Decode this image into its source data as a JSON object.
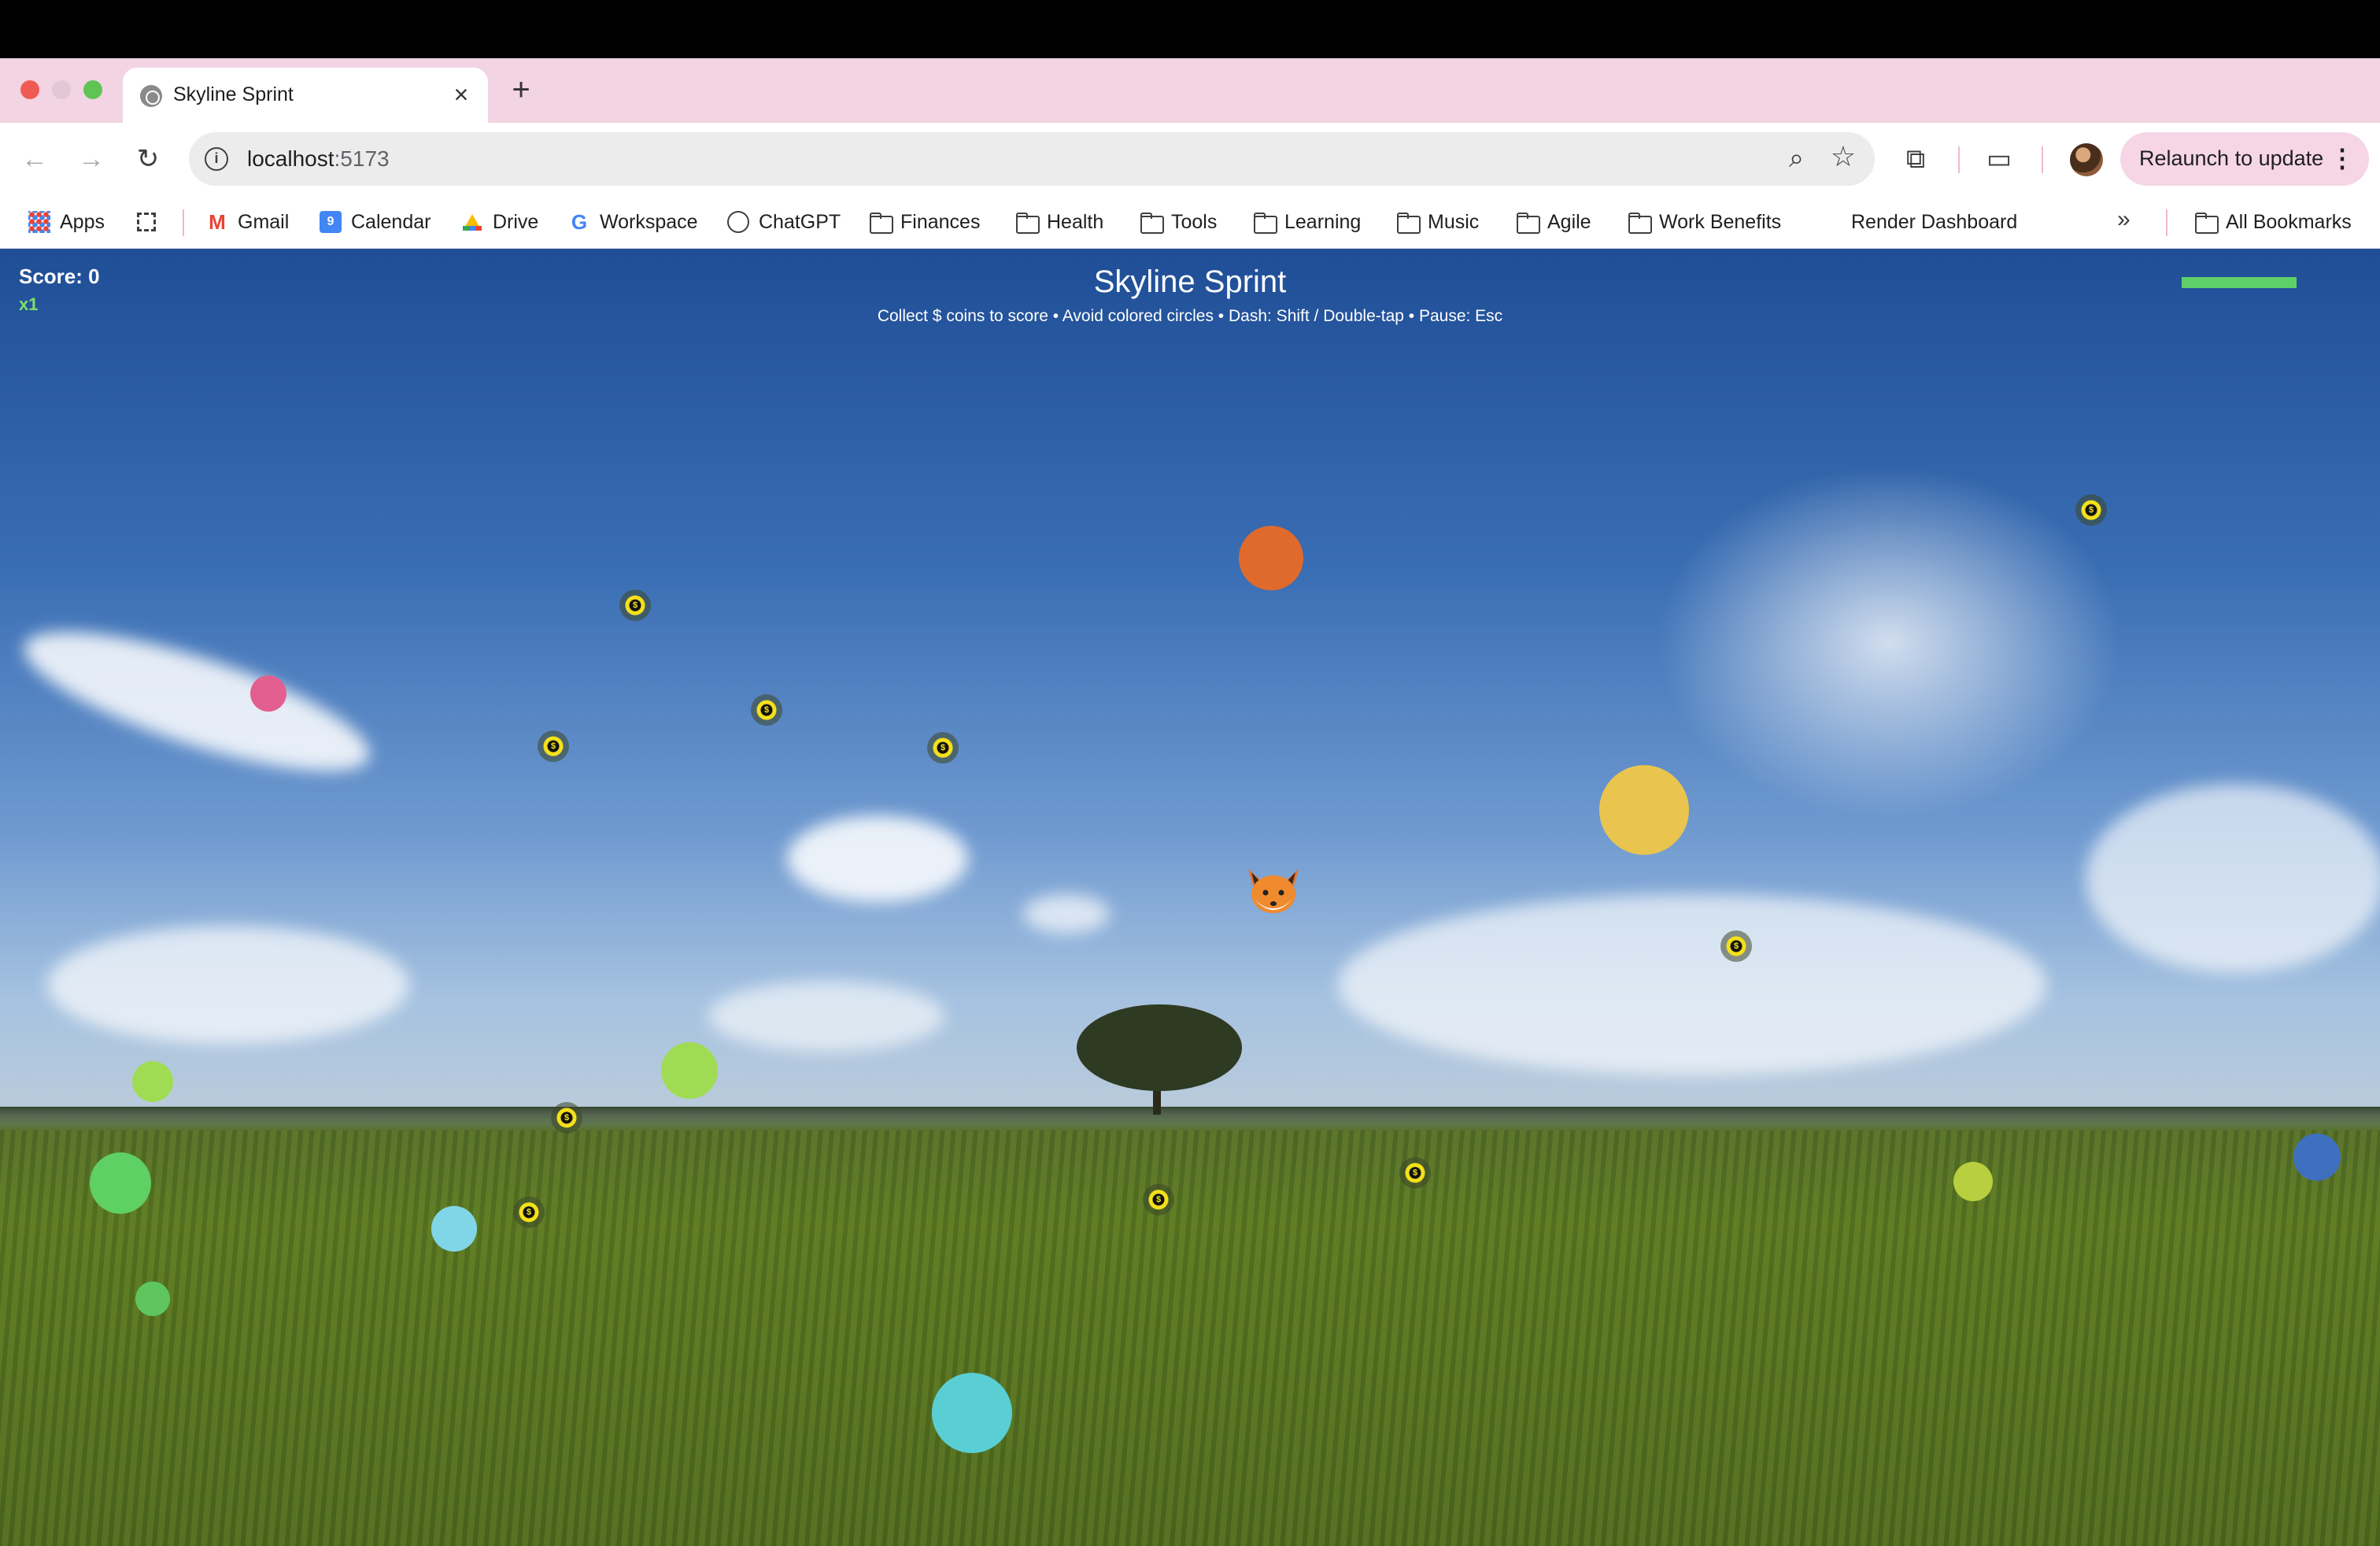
{
  "browser": {
    "tab_title": "Skyline Sprint",
    "url_host": "localhost",
    "url_port": ":5173",
    "relaunch_label": "Relaunch to update",
    "bookmarks": [
      "Apps",
      "Gmail",
      "Calendar",
      "Drive",
      "Workspace",
      "ChatGPT",
      "Finances",
      "Health",
      "Tools",
      "Learning",
      "Music",
      "Agile",
      "Work Benefits",
      "Render Dashboard",
      "All Bookmarks"
    ],
    "calendar_icon_day": "9"
  },
  "game": {
    "score_text": "Score: 0",
    "multiplier_text": "x1",
    "title": "Skyline Sprint",
    "instructions": "Collect $ coins to score • Avoid colored circles • Dash: Shift / Double-tap • Pause: Esc",
    "dash_meter_fraction": 1.0,
    "coin_symbol": "$",
    "player_icon": "fox-icon",
    "colors": {
      "dash_meter": "#5fcf6a",
      "multiplier": "#7ee06a",
      "coin": "#f5e11a"
    },
    "obstacle_colors": [
      "#e06a2c",
      "#e35f8f",
      "#e9c54f",
      "#9fdc54",
      "#5fd063",
      "#5ec55f",
      "#80d6e6",
      "#59cfd4",
      "#b8cf3f",
      "#3f6fbf"
    ]
  }
}
